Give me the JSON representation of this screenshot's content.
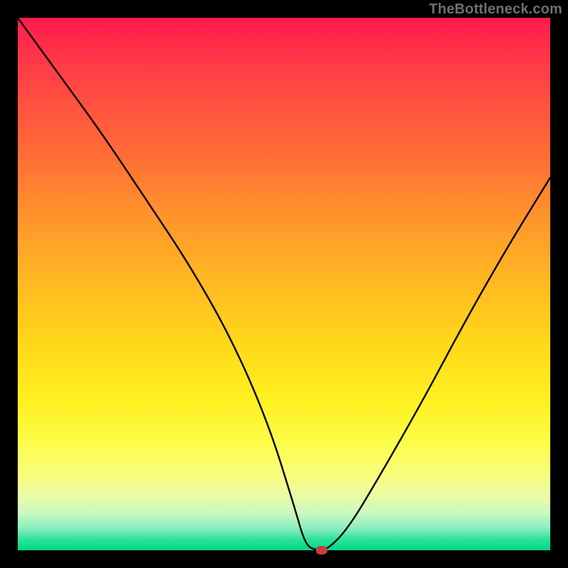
{
  "brand": {
    "text": "TheBottleneck.com"
  },
  "colors": {
    "frame": "#000000",
    "marker": "#c63f3c",
    "gradient_top": "#ff1a4d",
    "gradient_bottom": "#00d886"
  },
  "chart_data": {
    "type": "line",
    "title": "",
    "xlabel": "",
    "ylabel": "",
    "xlim": [
      0,
      100
    ],
    "ylim": [
      0,
      100
    ],
    "grid": false,
    "legend": false,
    "series": [
      {
        "name": "bottleneck-curve",
        "x": [
          0,
          8,
          16,
          24,
          32,
          40,
          47,
          52,
          54,
          56,
          58,
          62,
          68,
          76,
          84,
          92,
          100
        ],
        "y": [
          100,
          89,
          78,
          66,
          54,
          40,
          24,
          8,
          1,
          0,
          0,
          4,
          14,
          28,
          43,
          57,
          70
        ]
      }
    ],
    "annotations": [
      {
        "name": "ideal-point",
        "x": 57,
        "y": 0
      }
    ]
  }
}
